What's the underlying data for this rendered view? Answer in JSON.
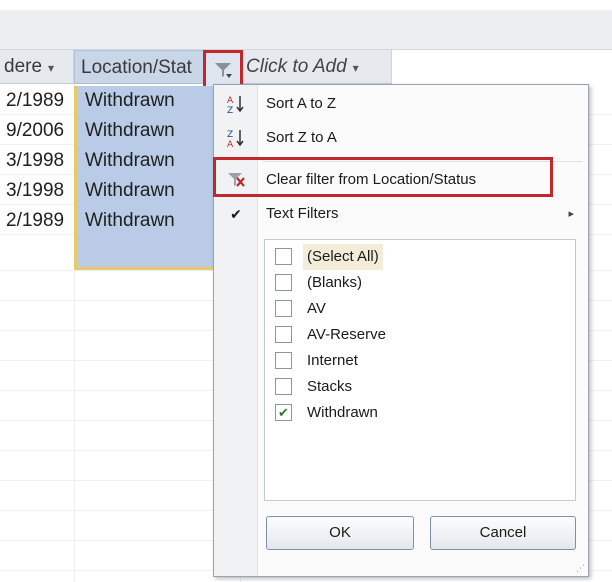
{
  "columns": {
    "col1_label": "dere",
    "col2_label": "Location/Stat",
    "col3_label": "Click to Add",
    "dropdown_arrow": "▾"
  },
  "rows": [
    {
      "date": "2/1989",
      "status": "Withdrawn"
    },
    {
      "date": "9/2006",
      "status": "Withdrawn"
    },
    {
      "date": "3/1998",
      "status": "Withdrawn"
    },
    {
      "date": "3/1998",
      "status": "Withdrawn"
    },
    {
      "date": "2/1989",
      "status": "Withdrawn"
    }
  ],
  "menu": {
    "sort_az": "Sort A to Z",
    "sort_za": "Sort Z to A",
    "clear_filter": "Clear filter from Location/Status",
    "text_filters": "Text Filters",
    "submenu_arrow": "▸",
    "check_glyph": "✔"
  },
  "filter_list": [
    {
      "label": "(Select All)",
      "checked": false
    },
    {
      "label": "(Blanks)",
      "checked": false
    },
    {
      "label": "AV",
      "checked": false
    },
    {
      "label": "AV-Reserve",
      "checked": false
    },
    {
      "label": "Internet",
      "checked": false
    },
    {
      "label": "Stacks",
      "checked": false
    },
    {
      "label": "Withdrawn",
      "checked": true
    }
  ],
  "buttons": {
    "ok": "OK",
    "cancel": "Cancel"
  },
  "icons": {
    "filter": "filter-icon",
    "sort_az": "sort-ascending-icon",
    "sort_za": "sort-descending-icon",
    "clear_filter": "clear-filter-icon"
  },
  "colors": {
    "highlight_red": "#c0282d",
    "selected_column": "#b9cbe6",
    "checkmark_green": "#2a7a2a"
  }
}
